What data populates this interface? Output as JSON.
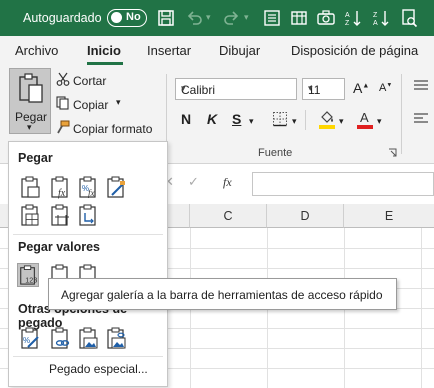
{
  "titlebar": {
    "autosave_label": "Autoguardado",
    "toggle_state": "No",
    "icons": [
      "save-icon",
      "undo-icon",
      "redo-icon",
      "form-icon",
      "table-icon",
      "camera-icon",
      "sort-ascending-icon",
      "sort-descending-icon",
      "print-preview-icon"
    ]
  },
  "tabs": [
    {
      "label": "Archivo"
    },
    {
      "label": "Inicio"
    },
    {
      "label": "Insertar"
    },
    {
      "label": "Dibujar"
    },
    {
      "label": "Disposición de página"
    }
  ],
  "active_tab": "Inicio",
  "ribbon": {
    "paste_label": "Pegar",
    "cut_label": "Cortar",
    "copy_label": "Copiar",
    "format_painter_label": "Copiar formato",
    "font_name": "Calibri",
    "font_size": "11",
    "bold_label": "N",
    "italic_label": "K",
    "underline_label": "S",
    "font_group_label": "Fuente",
    "fill_color": "#ffd600",
    "font_color": "#e02020"
  },
  "formula_bar": {
    "fx_label": "fx"
  },
  "grid": {
    "columns": [
      "C",
      "D",
      "E"
    ]
  },
  "paste_menu": {
    "heading_paste": "Pegar",
    "heading_values": "Pegar valores",
    "heading_other": "Otras opciones de pegado",
    "special_label": "Pegado especial..."
  },
  "tooltip": {
    "text": "Agregar galería a la barra de herramientas de acceso rápido"
  },
  "colors": {
    "brand_green": "#217346",
    "ribbon_bg": "#f3f3f3"
  }
}
